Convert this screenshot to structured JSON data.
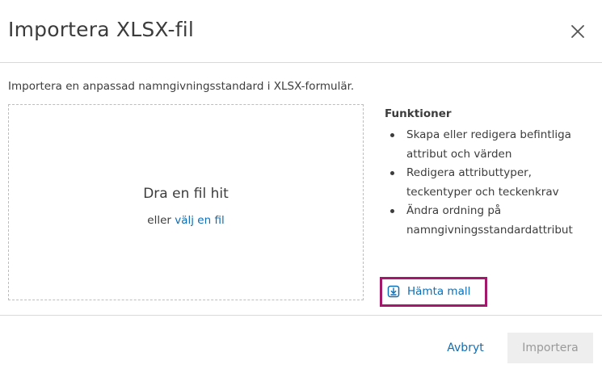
{
  "dialog": {
    "title": "Importera XLSX-fil",
    "close_icon": "close-icon",
    "description": "Importera en anpassad namngivningsstandard i XLSX-formulär."
  },
  "dropzone": {
    "title": "Dra en fil hit",
    "sub_prefix": "eller",
    "sub_link": "välj en fil"
  },
  "features": {
    "title": "Funktioner",
    "items": [
      "Skapa eller redigera befintliga attribut och värden",
      "Redigera attributtyper, teckentyper och teckenkrav",
      "Ändra ordning på namngivningsstandardattribut"
    ]
  },
  "template": {
    "label": "Hämta mall",
    "icon": "download-icon",
    "highlight_color": "#a3186a"
  },
  "footer": {
    "cancel_label": "Avbryt",
    "import_label": "Importera"
  },
  "colors": {
    "link": "#0f6eb5",
    "text": "#3c3c3c",
    "disabled_bg": "#eeeeee",
    "disabled_text": "#9a9a9a"
  }
}
